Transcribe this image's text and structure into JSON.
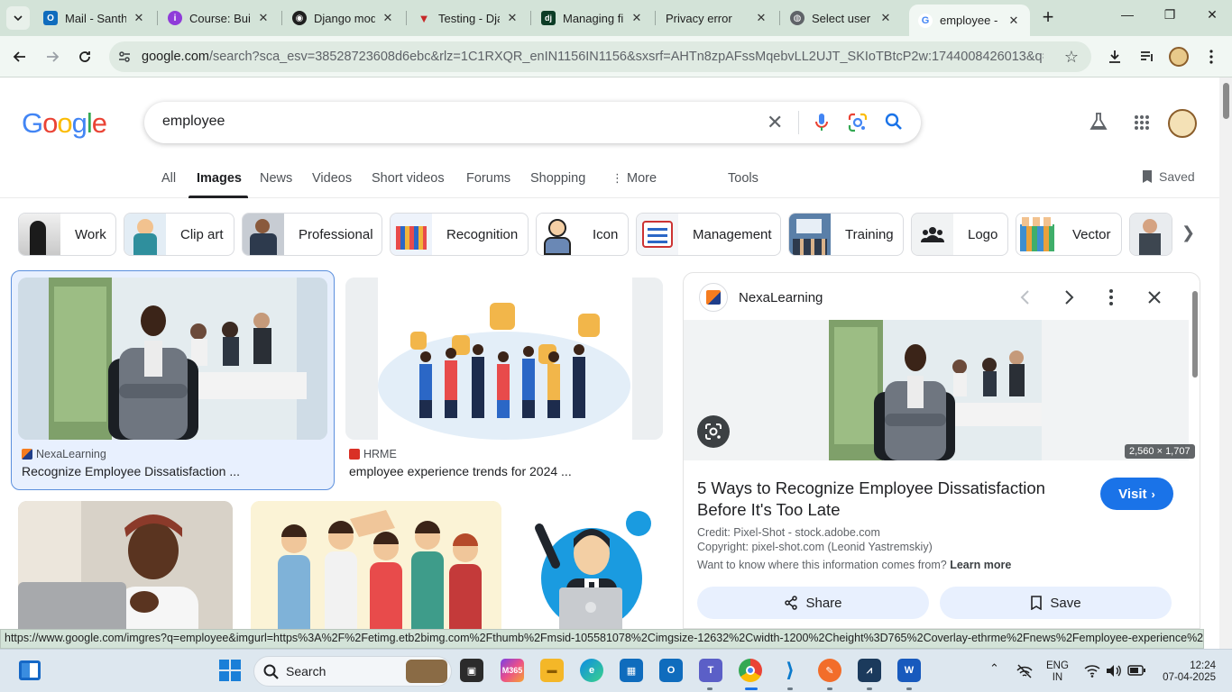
{
  "browser": {
    "tabs": [
      {
        "label": "Mail - Santh",
        "favicon_color": "#0f6cbd",
        "favicon": "O"
      },
      {
        "label": "Course: Build",
        "favicon_color": "#8f3bd9",
        "favicon": "i"
      },
      {
        "label": "Django mod",
        "favicon_color": "#1f1f1f",
        "favicon": "◉"
      },
      {
        "label": "Testing - Dja",
        "favicon_color": "#c62828",
        "favicon": "▼"
      },
      {
        "label": "Managing fil",
        "favicon_color": "#0c3c26",
        "favicon": "dj"
      },
      {
        "label": "Privacy error",
        "favicon_color": "#d93025",
        "favicon": "!"
      },
      {
        "label": "Select user t",
        "favicon_color": "#5f6368",
        "favicon": "◍"
      },
      {
        "label": "employee - G",
        "favicon_color": "#ffffff",
        "favicon": "G"
      }
    ],
    "url_host": "google.com",
    "url_rest": "/search?sca_esv=38528723608d6ebc&rlz=1C1RXQR_enIN1156IN1156&sxsrf=AHTn8zpAFssMqebvLL2UJT_SKIoTBtcP2w:1744008426013&q=employe..."
  },
  "google": {
    "query": "employee",
    "tabs": [
      "All",
      "Images",
      "News",
      "Videos",
      "Short videos",
      "Forums",
      "Shopping",
      "More",
      "Tools"
    ],
    "saved_label": "Saved",
    "chips": [
      "Work",
      "Clip art",
      "Professional",
      "Recognition",
      "Icon",
      "Management",
      "Training",
      "Logo",
      "Vector"
    ],
    "results": [
      {
        "source": "NexaLearning",
        "title": "Recognize Employee Dissatisfaction ..."
      },
      {
        "source": "HRME",
        "title": "employee experience trends for 2024 ..."
      }
    ],
    "panel": {
      "source": "NexaLearning",
      "dimensions": "2,560 × 1,707",
      "title": "5 Ways to Recognize Employee Dissatisfaction Before It's Too Late",
      "visit_label": "Visit",
      "credit": "Credit: Pixel-Shot - stock.adobe.com",
      "copyright": "Copyright: pixel-shot.com (Leonid Yastremskiy)",
      "info_prefix": "Want to know where this information comes from?",
      "learn_more": "Learn more",
      "share_label": "Share",
      "save_label": "Save"
    }
  },
  "status_url": "https://www.google.com/imgres?q=employee&imgurl=https%3A%2F%2Fetimg.etb2bimg.com%2Fthumb%2Fmsid-105581078%2Cimgsize-12632%2Cwidth-1200%2Cheight%3D765%2Coverlay-ethrme%2Fnews%2Femployee-experience%2Fnavigati...",
  "taskbar": {
    "search_label": "Search",
    "lang": "ENG",
    "region": "IN",
    "time": "12:24",
    "date": "07-04-2025"
  }
}
